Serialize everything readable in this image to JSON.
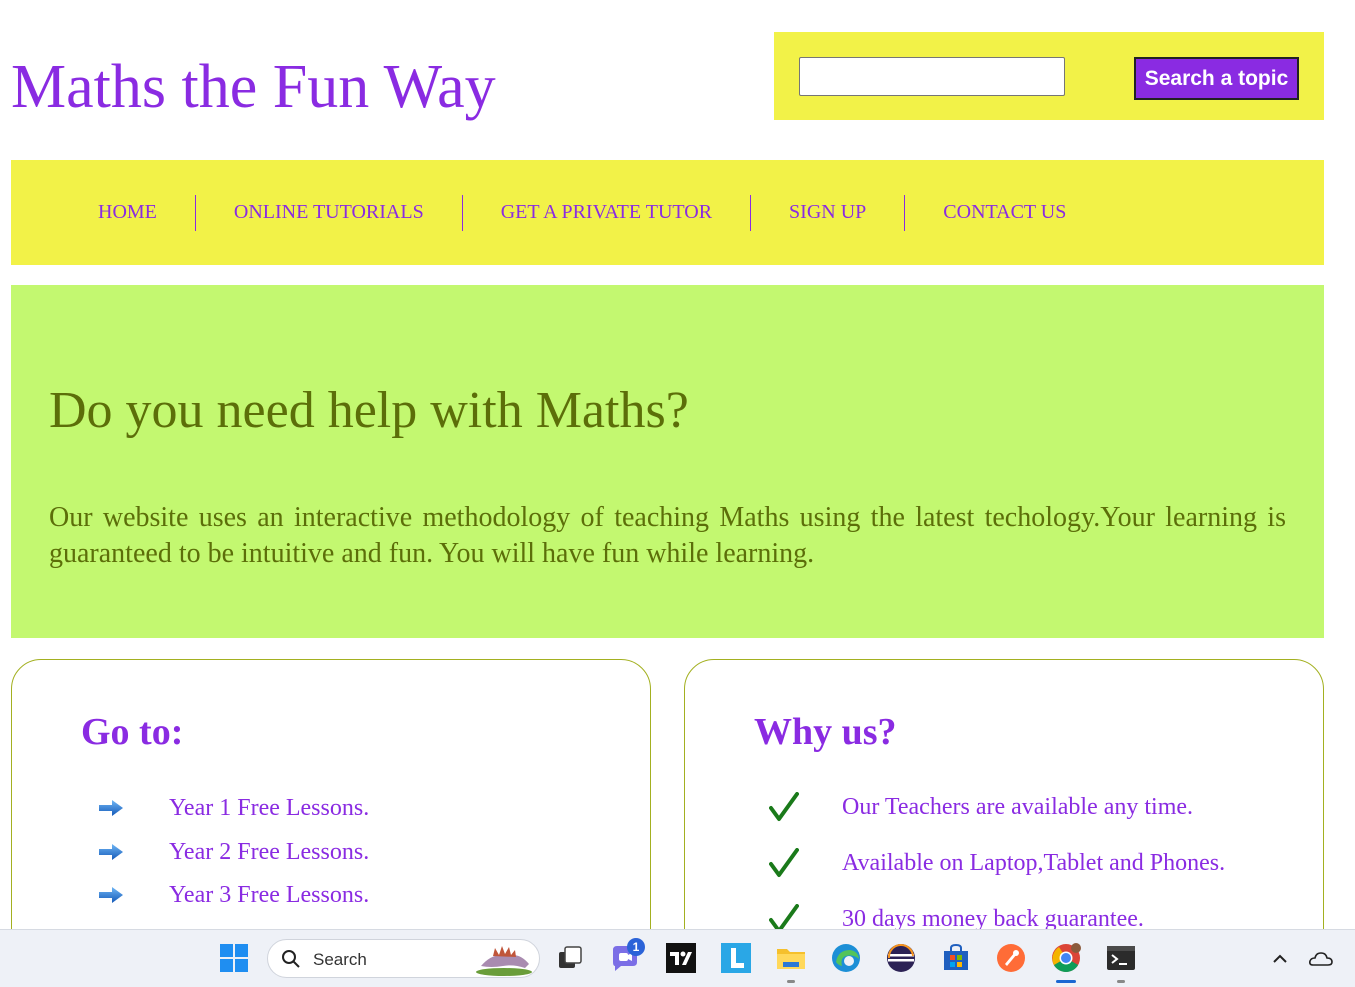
{
  "header": {
    "site_title": "Maths the Fun Way",
    "search_placeholder": "",
    "search_button": "Search a topic"
  },
  "nav": {
    "items": [
      {
        "label": "HOME"
      },
      {
        "label": "ONLINE TUTORIALS"
      },
      {
        "label": "GET A PRIVATE TUTOR"
      },
      {
        "label": "SIGN UP"
      },
      {
        "label": "CONTACT US"
      }
    ]
  },
  "hero": {
    "heading": "Do you need help with Maths?",
    "text": "Our website uses an interactive methodology of teaching Maths using the latest techology.Your learning is guaranteed to be intuitive and fun. You will have fun while learning."
  },
  "goto": {
    "heading": "Go to:",
    "items": [
      {
        "label": "Year 1 Free Lessons.",
        "icon": "arrow-right-icon"
      },
      {
        "label": "Year 2 Free Lessons.",
        "icon": "arrow-right-icon"
      },
      {
        "label": "Year 3 Free Lessons.",
        "icon": "arrow-right-icon"
      }
    ]
  },
  "why": {
    "heading": "Why us?",
    "items": [
      {
        "label": "Our Teachers are available any time.",
        "icon": "checkmark-icon"
      },
      {
        "label": "Available on Laptop,Tablet and Phones.",
        "icon": "checkmark-icon"
      },
      {
        "label": "30 days money back guarantee.",
        "icon": "checkmark-icon"
      }
    ]
  },
  "taskbar": {
    "search_label": "Search",
    "teams_badge": "1",
    "apps": [
      "windows-start-icon",
      "search-icon",
      "task-view-icon",
      "teams-chat-icon",
      "tradingview-icon",
      "l-app-icon",
      "file-explorer-icon",
      "edge-icon",
      "eclipse-icon",
      "microsoft-store-icon",
      "postman-icon",
      "chrome-icon",
      "terminal-icon",
      "chevron-up-icon",
      "onedrive-icon"
    ]
  },
  "colors": {
    "brand_purple": "#8a2be2",
    "header_yellow": "#f2f248",
    "hero_green": "#c3f870",
    "hero_text": "#5c6e09",
    "card_border": "#a3b020"
  }
}
